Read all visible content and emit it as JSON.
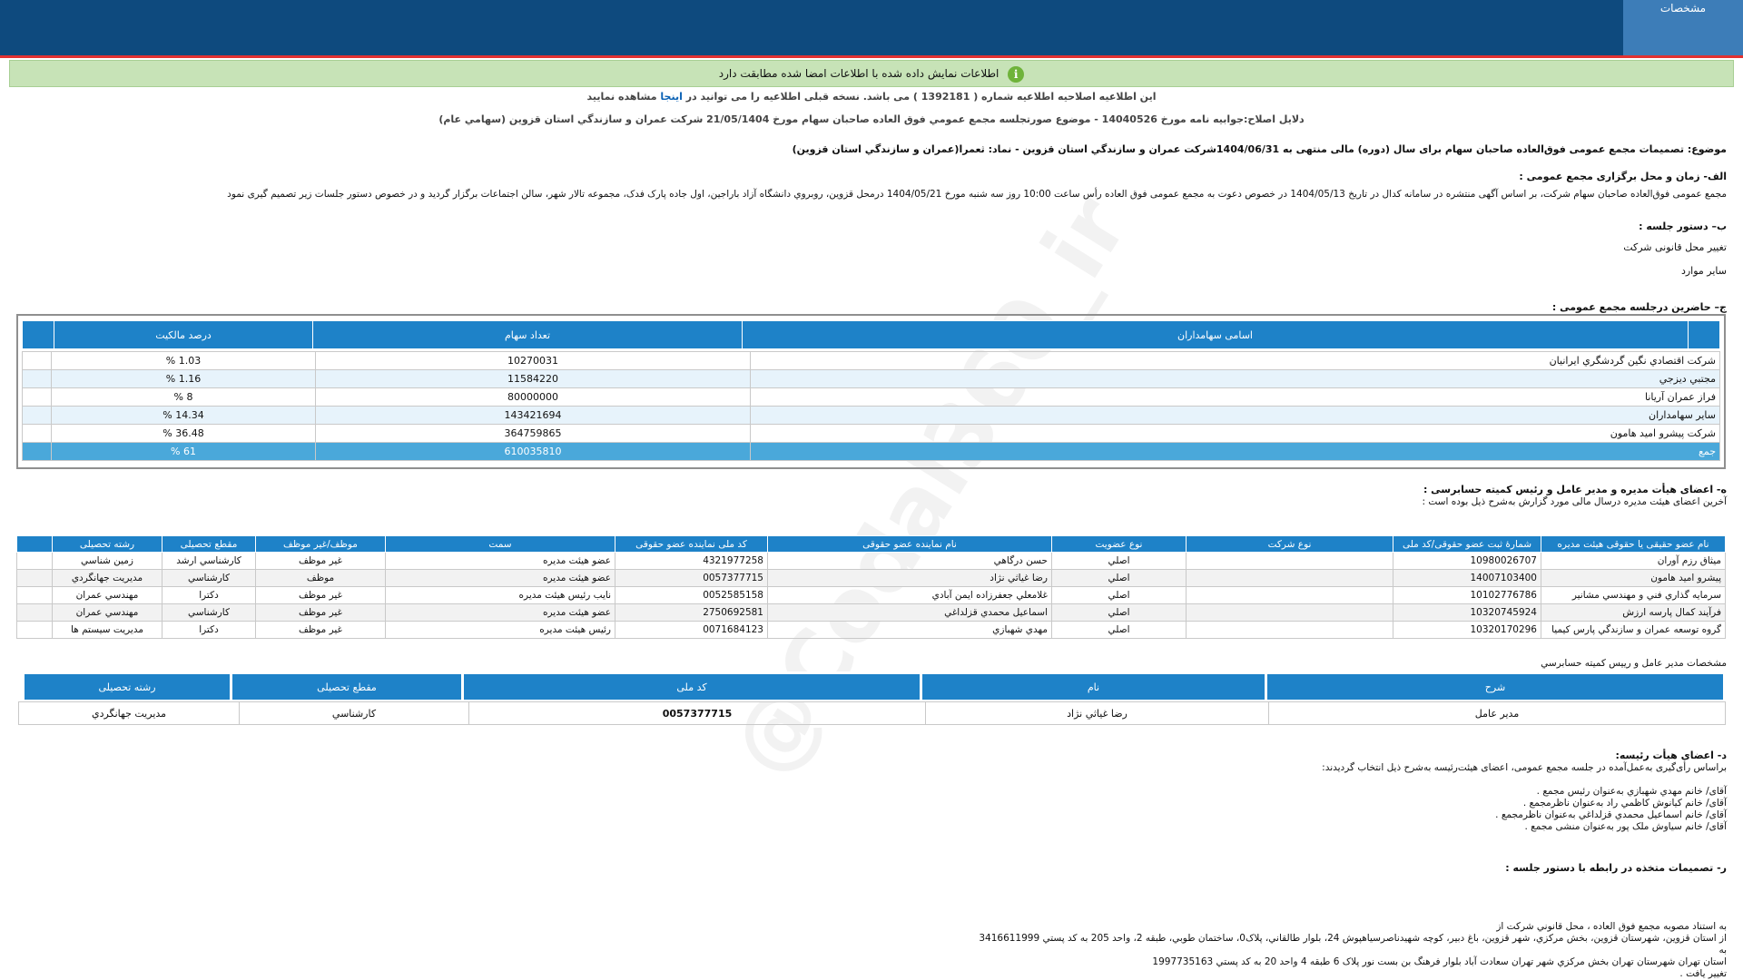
{
  "header": {
    "tab_label": "مشخصات"
  },
  "notice": {
    "text": "اطلاعات نمایش داده شده با اطلاعات امضا شده مطابقت دارد",
    "icon": "info-icon",
    "accent": "#6fb33a"
  },
  "amendment": {
    "pre": "این اطلاعیه اصلاحیه اطلاعیه شماره ( 1392181 ) می باشد. نسخه قبلی اطلاعیه را می توانید در",
    "link": "اینجا",
    "post": "مشاهده نمایید",
    "reason": "دلایل اصلاح:جوابیه نامه مورخ 14040526 - موضوع صورتجلسه مجمع عمومي فوق العاده صاحبان سهام مورخ 21/05/1404 شرکت عمران و سازندگي استان قزوين (سهامي عام)"
  },
  "subject": "موضوع: تصمیمات مجمع عمومی فوق‌العاده صاحبان سهام برای سال (دوره) مالی منتهی به 1404/06/31شرکت عمران و سازندگي استان قزوين - نماد: ثعمرا(عمران و سازندگي استان قزوين)",
  "section_a": {
    "title": "الف- زمان و محل برگزاری مجمع عمومی :",
    "text": "مجمع عمومی فوق‌العاده صاحبان سهام شرکت، بر اساس آگهی منتشره در سامانه کدال در تاریخ 1404/05/13 در خصوص دعوت به مجمع عمومی فوق العاده رأس ساعت 10:00 روز سه شنبه مورخ 1404/05/21 درمحل قزوين، روبروي دانشگاه آزاد باراجين، اول جاده پارک فدک، مجموعه تالار شهر، سالن اجتماعات     برگزار گردید و در خصوص دستور جلسات زیر تصمیم گیری نمود"
  },
  "section_b": {
    "title": "ب– دستور جلسه :",
    "items": [
      "تغییر محل قانونی شرکت",
      "سایر موارد"
    ]
  },
  "section_c": {
    "title": "ج– حاضرین درجلسه مجمع عمومی :",
    "headers": [
      "اسامی سهامداران",
      "تعداد سهام",
      "درصد مالکیت"
    ],
    "rows": [
      {
        "name": "شرکت اقتصادي نگين گردشگري ايرانيان",
        "shares": "10270031",
        "pct": "1.03 %"
      },
      {
        "name": "مجتبي ديزجي",
        "shares": "11584220",
        "pct": "1.16 %"
      },
      {
        "name": "فراز عمران آريانا",
        "shares": "80000000",
        "pct": "8 %"
      },
      {
        "name": "ساير سهامداران",
        "shares": "143421694",
        "pct": "14.34 %"
      },
      {
        "name": "شرکت پيشرو اميد هامون",
        "shares": "364759865",
        "pct": "36.48 %"
      }
    ],
    "total": {
      "name": "جمع",
      "shares": "610035810",
      "pct": "61 %"
    }
  },
  "section_d": {
    "title": "ه- اعضای هیأت مدیره و مدیر عامل و رئیس کمیته حسابرسی :",
    "subtitle": "آخرین اعضای هیئت مدیره درسال مالی مورد گزارش به‌شرح ذیل بوده است :",
    "headers": [
      "نام عضو حقیقی یا حقوقی هیئت مدیره",
      "شمارهٔ ثبت عضو حقوقی/کد ملی",
      "نوع شرکت",
      "نوع عضویت",
      "نام نماینده عضو حقوقی",
      "کد ملی نماینده عضو حقوقی",
      "سمت",
      "موظف/غیر موظف",
      "مقطع تحصیلی",
      "رشته تحصیلی"
    ],
    "rows": [
      [
        "ميثاق رزم آوران",
        "10980026707",
        "",
        "اصلي",
        "حسن درگاهي",
        "4321977258",
        "عضو هيئت مديره",
        "غير موظف",
        "کارشناسي ارشد",
        "زمين شناسي"
      ],
      [
        "پيشرو اميد هامون",
        "14007103400",
        "",
        "اصلي",
        "رضا غياثي نژاد",
        "0057377715",
        "عضو هيئت مديره",
        "موظف",
        "کارشناسي",
        "مديريت جهانگردي"
      ],
      [
        "سرمايه گذاري فني و مهندسي مشانير",
        "10102776786",
        "",
        "اصلي",
        "غلامعلي جعفرزاده ايمن آبادي",
        "0052585158",
        "نايب رئيس هيئت مديره",
        "غير موظف",
        "دکترا",
        "مهندسي عمران"
      ],
      [
        "فرآيند کمال پارسه ارزش",
        "10320745924",
        "",
        "اصلي",
        "اسماعيل محمدي قزلداغي",
        "2750692581",
        "عضو هيئت مديره",
        "غير موظف",
        "کارشناسي",
        "مهندسي عمران"
      ],
      [
        "گروه توسعه عمران و سازندگي پارس کيميا",
        "10320170296",
        "",
        "اصلي",
        "مهدي شهبازي",
        "0071684123",
        "رئيس هيئت مديره",
        "غير موظف",
        "دکترا",
        "مديريت سيستم ها"
      ]
    ]
  },
  "ceo": {
    "title": "مشخصات مدير عامل و رييس کميته حسابرسي",
    "headers": [
      "شرح",
      "نام",
      "کد ملی",
      "مقطع تحصیلی",
      "رشته تحصیلی"
    ],
    "row": [
      "مدير عامل",
      "رضا غياثي نژاد",
      "0057377715",
      "کارشناسي",
      "مديريت جهانگردي"
    ]
  },
  "section_e": {
    "title": "د- اعضای هیأت رئیسه:",
    "intro": "براساس رأی‌گیری به‌عمل‌آمده در جلسه مجمع عمومی، اعضای هیئت‌رئیسه به‌شرح ذیل انتخاب گردیدند:",
    "items": [
      "آقای/ خانم   مهدي شهبازي   به‌عنوان رئیس مجمع .",
      "آقای/ خانم   کيانوش کاظمي راد   به‌عنوان ناظرمجمع .",
      "آقای/ خانم   اسماعيل محمدي قزلداغي   به‌عنوان ناظرمجمع .",
      "آقای/ خانم   سياوش ملک پور   به‌عنوان منشی مجمع ."
    ]
  },
  "section_f": {
    "title": "ر- تصمیمات متخذه در رابطه با دستور جلسه :",
    "lines": [
      "به استناد مصوبه مجمع فوق العاده ، محل قانوني شركت از",
      "از استان قزوين، شهرستان قزوين، بخش مرکزي، شهر قزوين، باغ دبير، کوچه شهيدناصرسياهپوش 24، بلوار طالقاني، پلاک0، ساختمان طوبي، طبقه 2، واحد 205 به کد پستي 3416611999",
      "به",
      "استان تهران شهرستان تهران بخش مرکزي شهر تهران سعادت آباد بلوار فرهنگ بن بست نور پلاک 6 طبقه 4 واحد 20 به کد پستي 1997735163",
      "تغيير يافت ."
    ]
  },
  "watermark": "@Codal360_ir"
}
